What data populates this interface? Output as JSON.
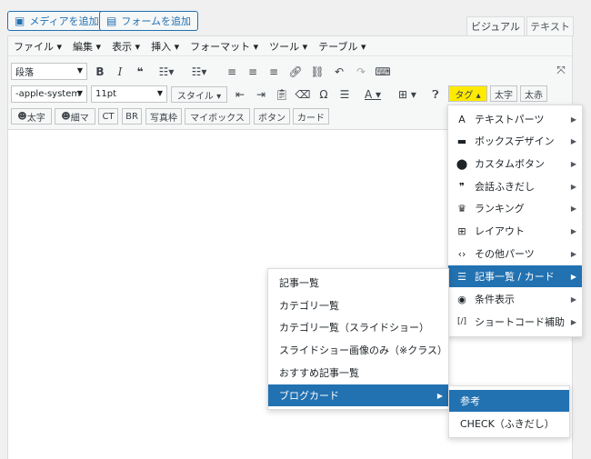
{
  "media_buttons": {
    "add_media": "メディアを追加",
    "add_form": "フォームを追加"
  },
  "mode_tabs": {
    "visual": "ビジュアル",
    "text": "テキスト"
  },
  "menubar": [
    "ファイル ▾",
    "編集 ▾",
    "表示 ▾",
    "挿入 ▾",
    "フォーマット ▾",
    "ツール ▾",
    "テーブル ▾"
  ],
  "toolbar1": {
    "format_select": "段落"
  },
  "toolbar2": {
    "font_family": "-apple-system",
    "font_size": "11pt",
    "style_button": "スタイル ▾",
    "tag_button": "タグ ▴",
    "bold_button": "太字",
    "bold_red_button": "太赤"
  },
  "toolbar3": {
    "buttons": [
      "太字",
      "細マ",
      "CT",
      "BR",
      "写真枠",
      "マイボックス",
      "ボタン",
      "カード"
    ]
  },
  "tag_menu": {
    "items": [
      {
        "icon": "A",
        "label": "テキストパーツ"
      },
      {
        "icon": "▬",
        "label": "ボックスデザイン"
      },
      {
        "icon": "⬤",
        "label": "カスタムボタン"
      },
      {
        "icon": "❞",
        "label": "会話ふきだし"
      },
      {
        "icon": "♛",
        "label": "ランキング"
      },
      {
        "icon": "⊞",
        "label": "レイアウト"
      },
      {
        "icon": "‹›",
        "label": "その他パーツ"
      },
      {
        "icon": "☰",
        "label": "記事一覧 / カード"
      },
      {
        "icon": "◉",
        "label": "条件表示"
      },
      {
        "icon": "[/]",
        "label": "ショートコード補助"
      }
    ],
    "highlighted_index": 7
  },
  "article_submenu": {
    "items": [
      "記事一覧",
      "カテゴリ一覧",
      "カテゴリ一覧（スライドショー）",
      "スライドショー画像のみ（※クラス）",
      "おすすめ記事一覧",
      "ブログカード"
    ],
    "highlighted_index": 5
  },
  "blogcard_submenu": {
    "items": [
      "参考",
      "CHECK（ふきだし）"
    ],
    "highlighted_index": 0
  },
  "colors": {
    "accent": "#2271b1",
    "tag_button_bg": "#ffea00"
  }
}
